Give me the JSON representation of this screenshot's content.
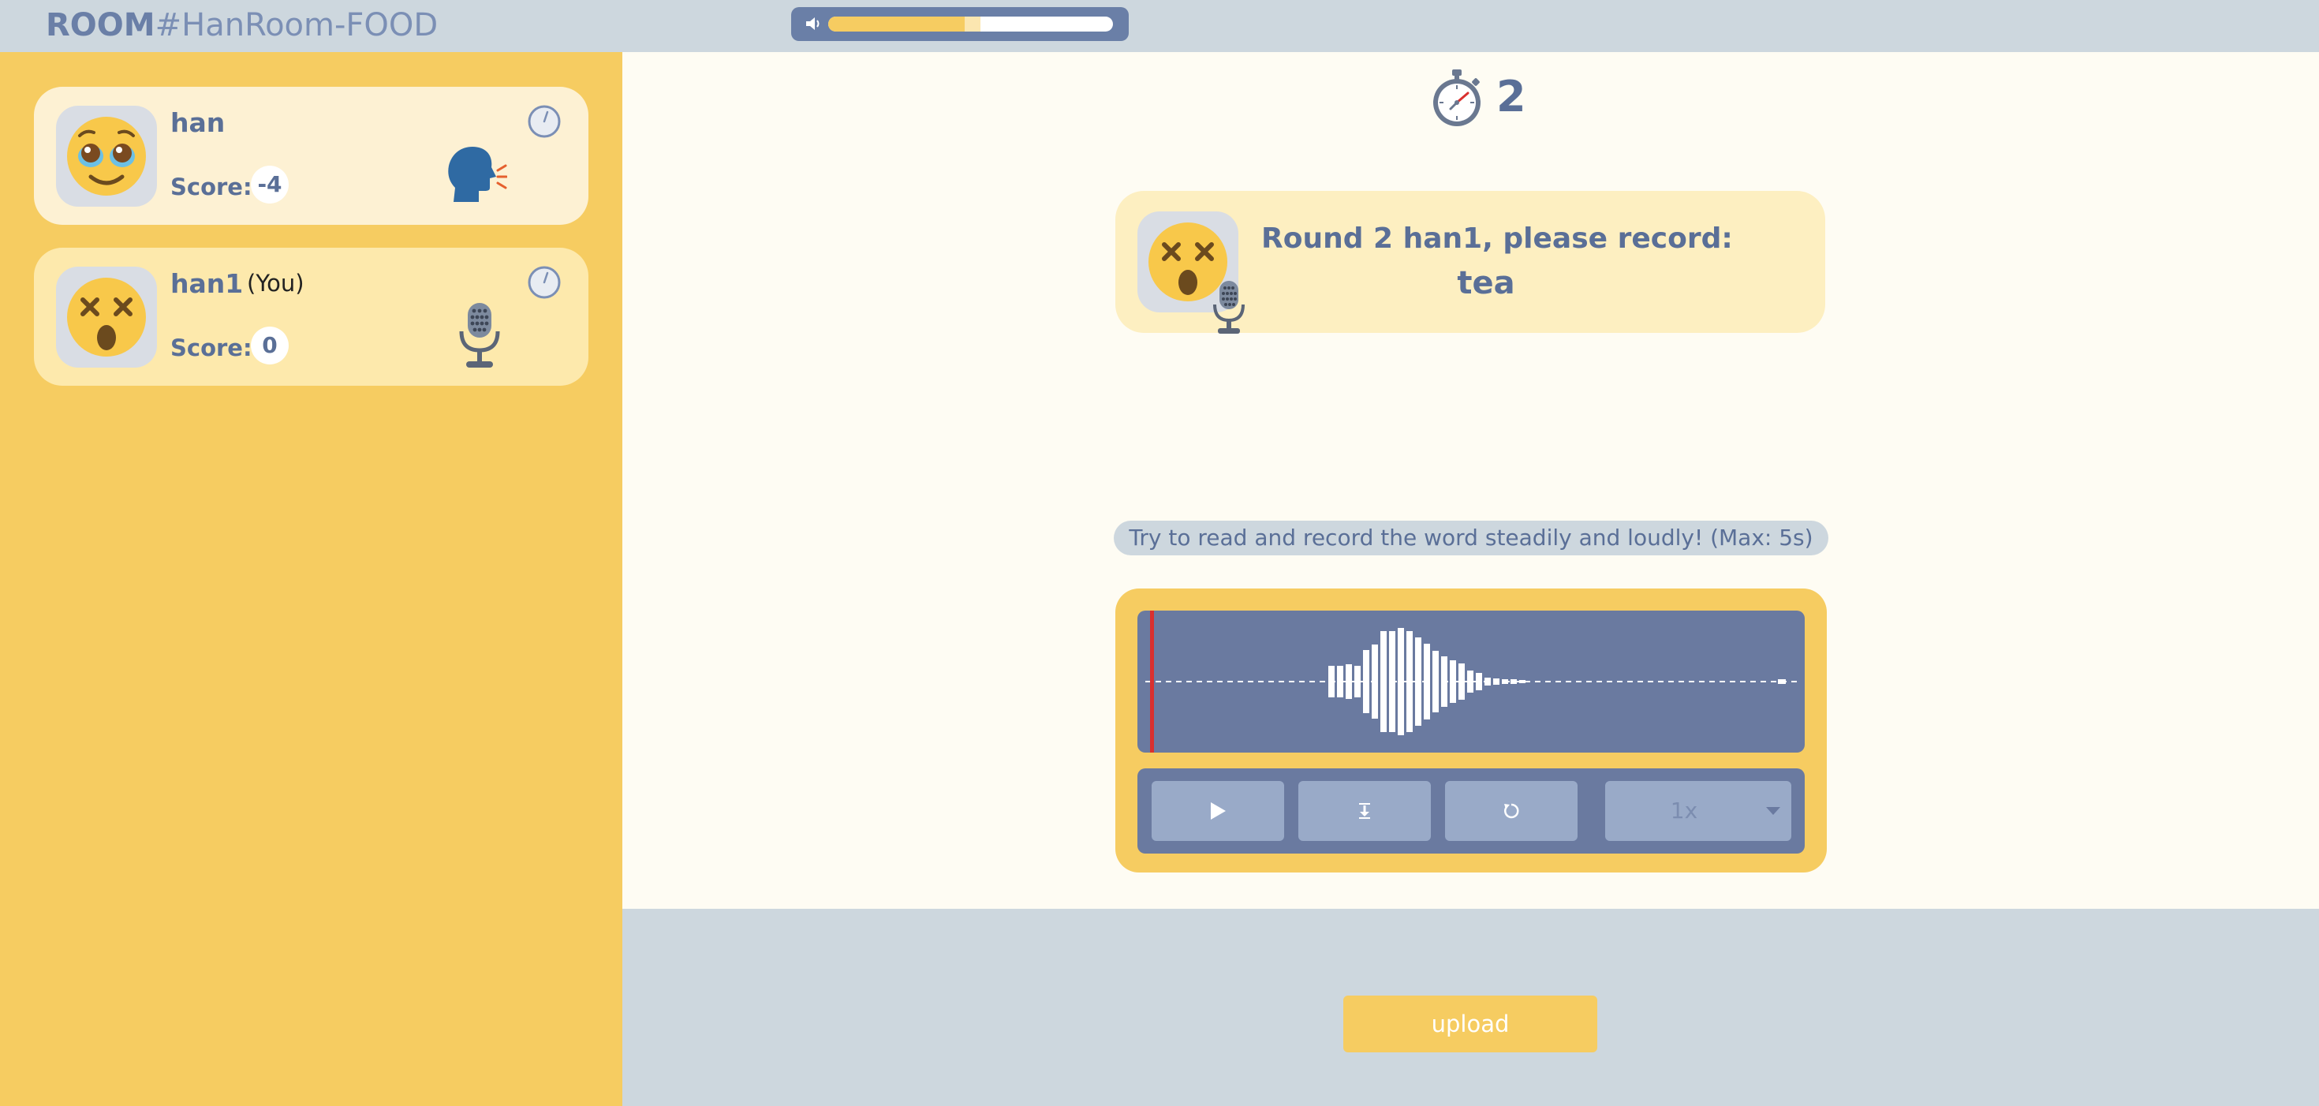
{
  "header": {
    "room_label": "ROOM",
    "room_name": "#HanRoom-FOOD",
    "volume_level": 0.48,
    "volume_icon": "speaker-icon"
  },
  "players": [
    {
      "name": "han",
      "you_label": "",
      "score_label": "Score:",
      "score": "-4",
      "avatar_icon": "pleading-face-icon",
      "status_icon": "speaking-head-icon"
    },
    {
      "name": "han1",
      "you_label": "(You)",
      "score_label": "Score:",
      "score": "0",
      "avatar_icon": "dizzy-face-icon",
      "status_icon": "microphone-icon"
    }
  ],
  "round": {
    "count": "2",
    "prompt": "Round 2 han1, please record:",
    "word": "tea"
  },
  "recorder": {
    "hint": "Try to read and record the word steadily and loudly! (Max: 5s)",
    "speed": "1x",
    "play_icon": "play-icon",
    "download_icon": "download-icon",
    "reset_icon": "reset-icon"
  },
  "upload": {
    "label": "upload"
  },
  "colors": {
    "accent": "#f6cc61",
    "text": "#5a6f97",
    "panel": "#6a7aa0",
    "background": "#cdd7de",
    "playhead": "#d9302f"
  }
}
